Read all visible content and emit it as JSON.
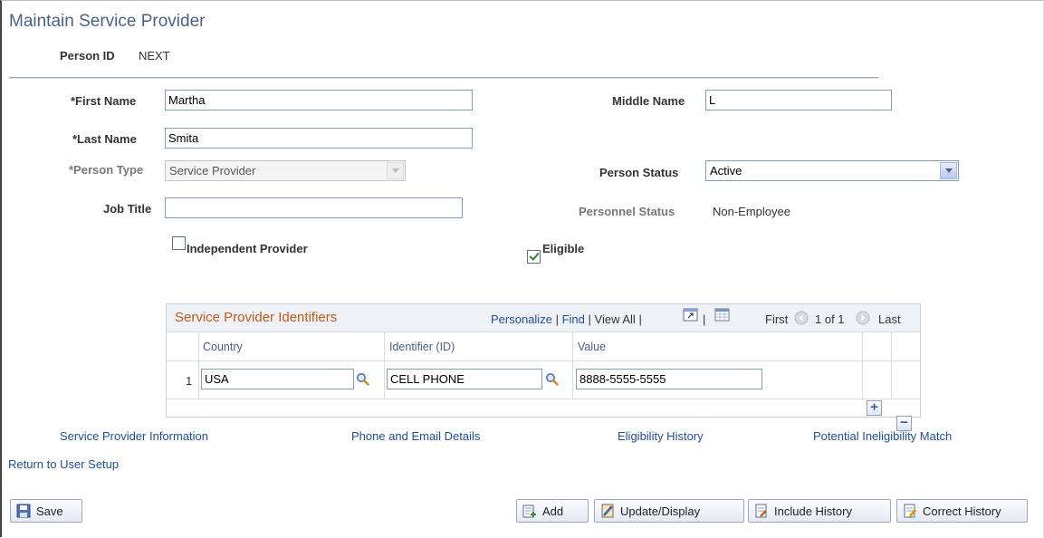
{
  "page": {
    "title": "Maintain Service Provider"
  },
  "person_id": {
    "label": "Person ID",
    "value": "NEXT"
  },
  "form": {
    "first_name": {
      "label": "*First Name",
      "value": "Martha"
    },
    "middle_name": {
      "label": "Middle Name",
      "value": "L"
    },
    "last_name": {
      "label": "*Last Name",
      "value": "Smita"
    },
    "person_type": {
      "label": "*Person Type",
      "value": "Service Provider"
    },
    "person_status": {
      "label": "Person Status",
      "value": "Active"
    },
    "job_title": {
      "label": "Job Title",
      "value": ""
    },
    "personnel_status": {
      "label": "Personnel Status",
      "value": "Non-Employee"
    },
    "independent_provider": {
      "label": "Independent Provider",
      "checked": false
    },
    "eligible": {
      "label": "Eligible",
      "checked": true
    }
  },
  "grid": {
    "title": "Service Provider Identifiers",
    "personalize": "Personalize",
    "find": "Find",
    "view_all": "View All",
    "sep": "|",
    "first": "First",
    "range": "1 of 1",
    "last": "Last",
    "columns": [
      "Country",
      "Identifier (ID)",
      "Value"
    ],
    "rows": [
      {
        "num": "1",
        "country": "USA",
        "identifier": "CELL PHONE",
        "value": "8888-5555-5555"
      }
    ]
  },
  "links": {
    "service_provider_info": "Service Provider Information",
    "phone_email": "Phone and Email Details",
    "eligibility_history": "Eligibility History",
    "potential_ineligibility": "Potential Ineligibility Match",
    "return_user_setup": "Return to User Setup"
  },
  "buttons": {
    "save": "Save",
    "add": "Add",
    "update_display": "Update/Display",
    "include_history": "Include History",
    "correct_history": "Correct History"
  }
}
